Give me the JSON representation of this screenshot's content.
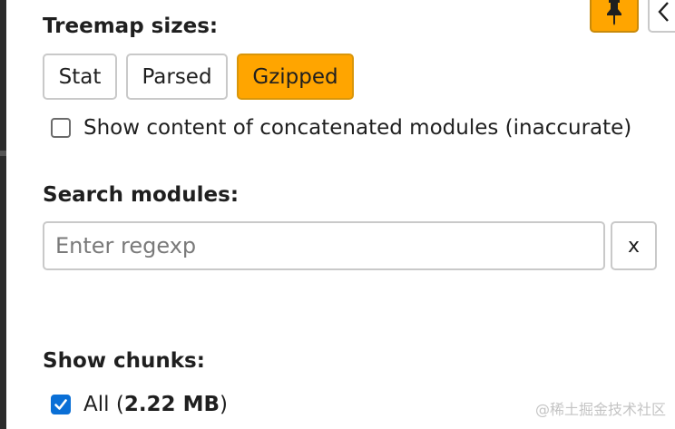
{
  "treemap": {
    "heading": "Treemap sizes:",
    "options": [
      {
        "label": "Stat",
        "active": false
      },
      {
        "label": "Parsed",
        "active": false
      },
      {
        "label": "Gzipped",
        "active": true
      }
    ],
    "concatenated_label": "Show content of concatenated modules (inaccurate)",
    "concatenated_checked": false
  },
  "search": {
    "heading": "Search modules:",
    "placeholder": "Enter regexp",
    "value": "",
    "clear_label": "x"
  },
  "chunks": {
    "heading": "Show chunks:",
    "all_prefix": "All (",
    "all_size": "2.22 MB",
    "all_suffix": ")",
    "all_checked": true
  },
  "toolbar": {
    "pin_icon": "pin-icon",
    "collapse_icon": "chevron-left-icon"
  },
  "watermark": "@稀土掘金技术社区",
  "colors": {
    "accent": "#ffa500",
    "checkbox": "#0a6fd6",
    "border": "#c9c9c9"
  }
}
